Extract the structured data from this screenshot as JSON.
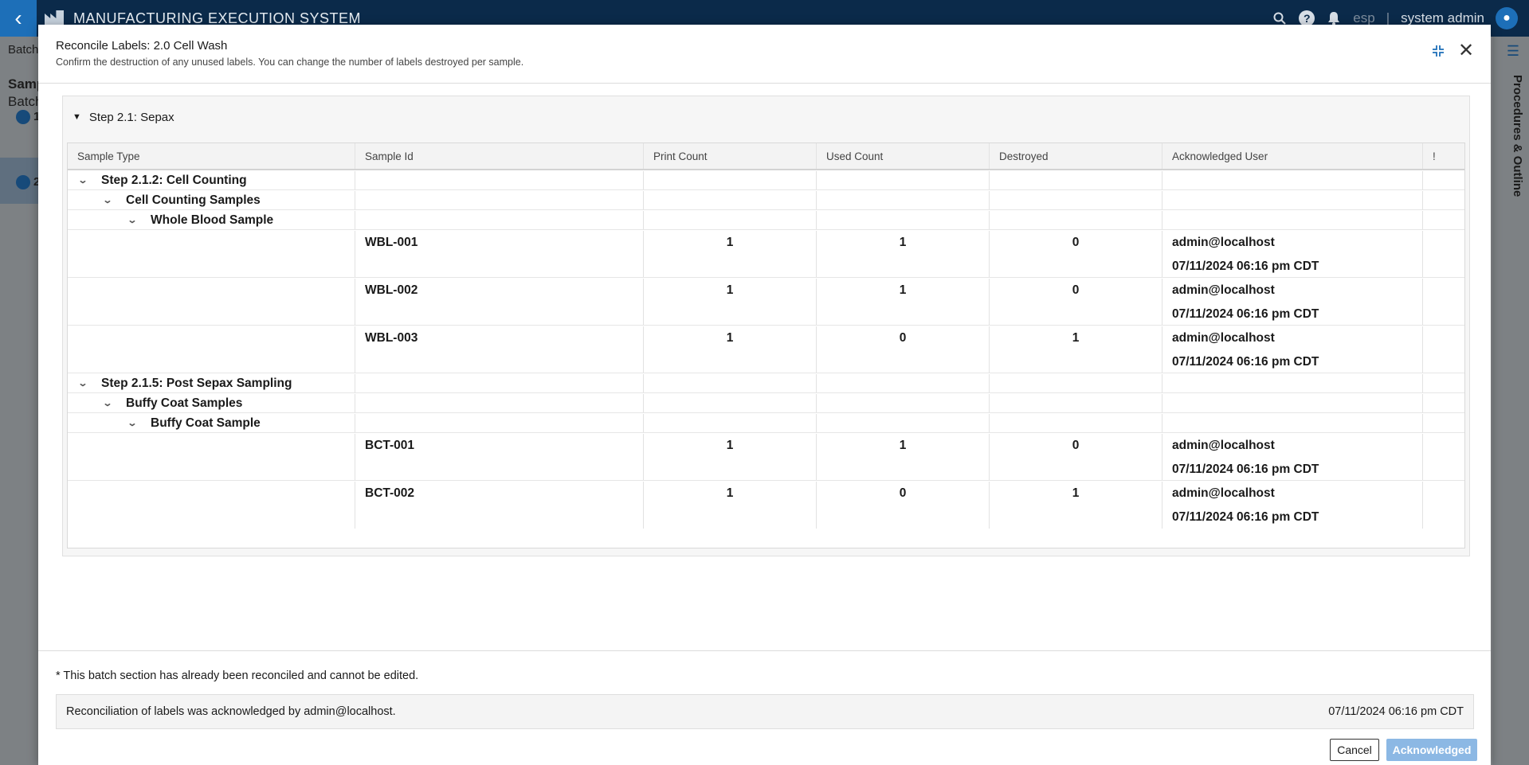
{
  "app": {
    "title": "MANUFACTURING EXECUTION SYSTEM",
    "org": "esp",
    "separator": "|",
    "user": "system admin",
    "left_tab": "Batch",
    "left_heading": "Samp",
    "left_sub": "Batch",
    "left_item_1": "1",
    "left_item_2": "2",
    "right_panel_label": "Procedures & Outline"
  },
  "modal": {
    "title": "Reconcile Labels: 2.0 Cell Wash",
    "subtitle": "Confirm the destruction of any unused labels. You can change the number of labels destroyed per sample.",
    "step_title": "Step 2.1: Sepax"
  },
  "table": {
    "columns": [
      "Sample Type",
      "Sample Id",
      "Print Count",
      "Used Count",
      "Destroyed",
      "Acknowledged User",
      "!"
    ],
    "groups": [
      {
        "label": "Step 2.1.2: Cell Counting",
        "level": 1
      },
      {
        "label": "Cell Counting Samples",
        "level": 2
      },
      {
        "label": "Whole Blood Sample",
        "level": 3
      },
      {
        "label": "Step 2.1.5: Post Sepax Sampling",
        "level": 1
      },
      {
        "label": "Buffy Coat Samples",
        "level": 2
      },
      {
        "label": "Buffy Coat Sample",
        "level": 3
      }
    ],
    "rows": [
      {
        "sample_id": "WBL-001",
        "print": "1",
        "used": "1",
        "destroyed": "0",
        "user": "admin@localhost",
        "time": "07/11/2024 06:16 pm CDT"
      },
      {
        "sample_id": "WBL-002",
        "print": "1",
        "used": "1",
        "destroyed": "0",
        "user": "admin@localhost",
        "time": "07/11/2024 06:16 pm CDT"
      },
      {
        "sample_id": "WBL-003",
        "print": "1",
        "used": "0",
        "destroyed": "1",
        "user": "admin@localhost",
        "time": "07/11/2024 06:16 pm CDT"
      },
      {
        "sample_id": "BCT-001",
        "print": "1",
        "used": "1",
        "destroyed": "0",
        "user": "admin@localhost",
        "time": "07/11/2024 06:16 pm CDT"
      },
      {
        "sample_id": "BCT-002",
        "print": "1",
        "used": "0",
        "destroyed": "1",
        "user": "admin@localhost",
        "time": "07/11/2024 06:16 pm CDT"
      }
    ]
  },
  "footer": {
    "note": "* This batch section has already been reconciled and cannot be edited.",
    "ack_message": "Reconciliation of labels was acknowledged by admin@localhost.",
    "ack_time": "07/11/2024 06:16 pm CDT",
    "cancel_label": "Cancel",
    "ack_label": "Acknowledged"
  },
  "icons": {
    "back": "chevron-left-icon",
    "search": "search-icon",
    "help": "help-icon",
    "bell": "bell-icon",
    "collapse": "collapse-icon",
    "close": "close-icon"
  },
  "colors": {
    "header_bg": "#0b2a4a",
    "accent": "#1d6fb8",
    "ack_button": "#8cb8e4"
  }
}
